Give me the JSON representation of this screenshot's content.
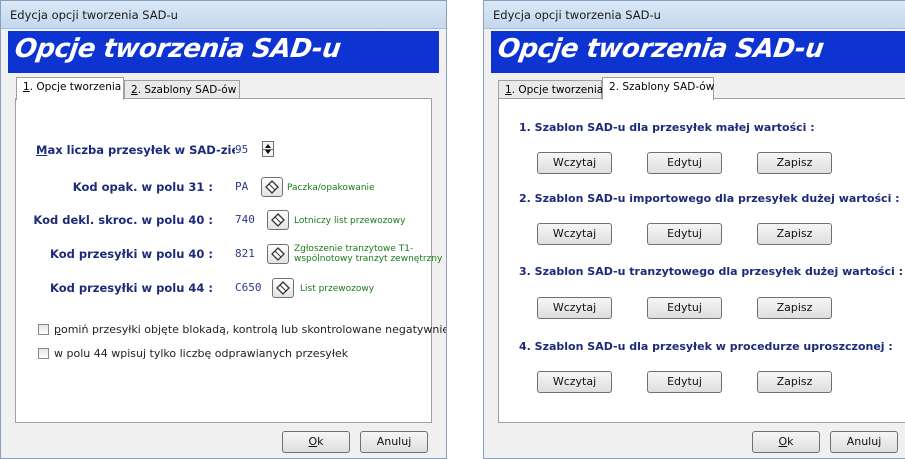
{
  "left_window": {
    "title": "Edycja opcji tworzenia SAD-u",
    "banner": "Opcje tworzenia SAD-u",
    "tabs": [
      {
        "num": "1",
        "label": ". Opcje tworzenia"
      },
      {
        "num": "2",
        "label": ". Szablony SAD-ów"
      }
    ],
    "max_label_first": "M",
    "max_label_rest": "ax liczba przesyłek w SAD-zie :",
    "max_value": "95",
    "rows": [
      {
        "label": "Kod opak. w polu 31 :",
        "value": "PA",
        "desc1": "Paczka/opakowanie",
        "desc2": ""
      },
      {
        "label": "Kod dekl. skroc. w polu 40 :",
        "value": "740",
        "desc1": "Lotniczy list przewozowy",
        "desc2": ""
      },
      {
        "label": "Kod przesyłki w polu 40 :",
        "value": "821",
        "desc1": "Zgłoszenie tranzytowe T1-",
        "desc2": "wspólnotowy tranzyt zewnętrzny"
      },
      {
        "label": "Kod przesyłki w polu 44 :",
        "value": "C650",
        "desc1": "List przewozowy",
        "desc2": ""
      }
    ],
    "checkboxes": [
      {
        "first": "p",
        "rest": "omiń przesyłki objęte blokadą, kontrolą lub skontrolowane negatywnie"
      },
      {
        "first": "",
        "rest": "w polu 44 wpisuj tylko liczbę odprawianych przesyłek"
      }
    ],
    "ok_first": "O",
    "ok_rest": "k",
    "cancel": "Anuluj"
  },
  "right_window": {
    "title": "Edycja opcji tworzenia SAD-u",
    "banner": "Opcje tworzenia SAD-u",
    "tabs": [
      {
        "num": "1",
        "label": ". Opcje tworzenia"
      },
      {
        "num": "2",
        "label": ". Szablony SAD-ów"
      }
    ],
    "sections": [
      {
        "title": "1. Szablon SAD-u dla przesyłek małej wartości :"
      },
      {
        "title": "2. Szablon SAD-u importowego dla przesyłek dużej wartości :"
      },
      {
        "title": "3. Szablon SAD-u tranzytowego dla przesyłek dużej wartości :"
      },
      {
        "title": "4. Szablon SAD-u dla przesyłek w procedurze uproszczonej :"
      }
    ],
    "load": "Wczytaj",
    "edit": "Edytuj",
    "save": "Zapisz",
    "ok_first": "O",
    "ok_rest": "k",
    "cancel": "Anuluj"
  }
}
